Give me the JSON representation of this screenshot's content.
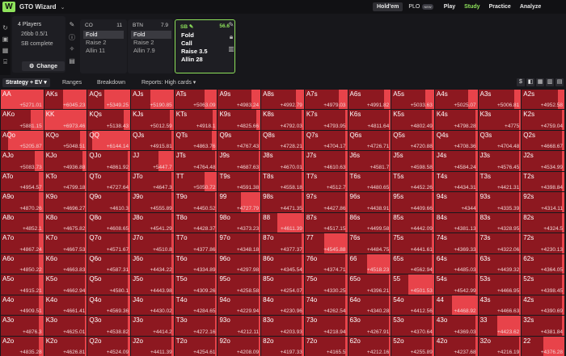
{
  "app": {
    "logo": "W",
    "brand": "GTO Wizard"
  },
  "nav": {
    "holdem": "Hold'em",
    "plo": "PLO",
    "new_badge": "NEW",
    "play": "Play",
    "study": "Study",
    "practice": "Practice",
    "analyze": "Analyze"
  },
  "settings": {
    "players": "4 Players",
    "stakes": "26bb 0.5/1",
    "status": "SB complete",
    "change_label": "Change"
  },
  "positions": [
    {
      "name": "CO",
      "stack": "11",
      "actions": [
        "Fold",
        "Raise 2",
        "Allin 11"
      ],
      "selected": 0
    },
    {
      "name": "BTN",
      "stack": "7.9",
      "actions": [
        "Fold",
        "Raise 2",
        "Allin 7.9"
      ],
      "selected": 0
    },
    {
      "name": "SB",
      "stack": "56.6",
      "actions": [
        "Fold",
        "Call",
        "Raise 3.5",
        "Allin 28"
      ],
      "selected": -1
    }
  ],
  "tabs": {
    "strategy": "Strategy + EV",
    "ranges": "Ranges",
    "breakdown": "Breakdown",
    "reports": "Reports: High cards"
  },
  "colors": {
    "accent": "#8ee25b",
    "fold": "#8d1820",
    "allin": "#e8434a"
  },
  "grid_rows": [
    [
      [
        "AA",
        "+5271.01",
        1
      ],
      [
        "AKs",
        "+6045.23",
        0.55
      ],
      [
        "AQs",
        "+5349.25",
        0.6
      ],
      [
        "AJs",
        "+5190.85",
        0.55
      ],
      [
        "ATs",
        "+5063.09",
        0.3
      ],
      [
        "A9s",
        "+4983.24",
        0.22
      ],
      [
        "A8s",
        "+4992.79",
        0.18
      ],
      [
        "A7s",
        "+4979.03",
        0.2
      ],
      [
        "A6s",
        "+4991.82",
        0.15
      ],
      [
        "A5s",
        "+5033.63",
        0.2
      ],
      [
        "A4s",
        "+5025.07",
        0.22
      ],
      [
        "A3s",
        "+5006.81",
        0.15
      ],
      [
        "A2s",
        "+4952.58",
        0.15
      ]
    ],
    [
      [
        "AKo",
        "+5881.15",
        0.3
      ],
      [
        "KK",
        "+6973.46",
        1
      ],
      [
        "KQs",
        "+5138.43",
        0.15
      ],
      [
        "KJs",
        "+5012.59",
        0.1
      ],
      [
        "KTs",
        "+4918.1",
        0.1
      ],
      [
        "K9s",
        "+4825.66",
        0.1
      ],
      [
        "K8s",
        "+4792.03",
        0.06
      ],
      [
        "K7s",
        "+4793.95",
        0.05
      ],
      [
        "K6s",
        "+4811.64",
        0.05
      ],
      [
        "K5s",
        "+4802.49",
        0.05
      ],
      [
        "K4s",
        "+4798.28",
        0.05
      ],
      [
        "K3s",
        "+4775",
        0.05
      ],
      [
        "K2s",
        "+4759.04",
        0.05
      ]
    ],
    [
      [
        "AQo",
        "+5205.87",
        0.82
      ],
      [
        "KQo",
        "+5048.51",
        0.15
      ],
      [
        "QQ",
        "+6144.14",
        0.9
      ],
      [
        "QJs",
        "+4915.81",
        0.05
      ],
      [
        "QTs",
        "+4863.76",
        0.12
      ],
      [
        "Q9s",
        "+4767.43",
        0.05
      ],
      [
        "Q8s",
        "+4728.21",
        0.05
      ],
      [
        "Q7s",
        "+4704.17",
        0.05
      ],
      [
        "Q6s",
        "+4726.71",
        0.05
      ],
      [
        "Q5s",
        "+4720.88",
        0.05
      ],
      [
        "Q4s",
        "+4708.36",
        0.05
      ],
      [
        "Q3s",
        "+4704.48",
        0.05
      ],
      [
        "Q2s",
        "+4668.67",
        0.05
      ]
    ],
    [
      [
        "AJo",
        "+5083.73",
        0.2
      ],
      [
        "KJo",
        "+4936.88",
        0.1
      ],
      [
        "QJo",
        "+4861.92",
        0.05
      ],
      [
        "JJ",
        "+5447.7",
        0.35
      ],
      [
        "JTs",
        "+4764.48",
        0.05
      ],
      [
        "J9s",
        "+4687.63",
        0.05
      ],
      [
        "J8s",
        "+4670.01",
        0.05
      ],
      [
        "J7s",
        "+4610.63",
        0.05
      ],
      [
        "J6s",
        "+4581.7",
        0.05
      ],
      [
        "J5s",
        "+4598.58",
        0.05
      ],
      [
        "J4s",
        "+4584.24",
        0.05
      ],
      [
        "J3s",
        "+4576.45",
        0.05
      ],
      [
        "J2s",
        "+4534.99",
        0.05
      ]
    ],
    [
      [
        "ATo",
        "+4954.57",
        0.1
      ],
      [
        "KTo",
        "+4799.18",
        0.05
      ],
      [
        "QTo",
        "+4727.64",
        0.05
      ],
      [
        "JTo",
        "+4647.3",
        0.05
      ],
      [
        "TT",
        "+5050.72",
        0.3
      ],
      [
        "T9s",
        "+4591.38",
        0.05
      ],
      [
        "T8s",
        "+4558.18",
        0.05
      ],
      [
        "T7s",
        "+4512.7",
        0.05
      ],
      [
        "T6s",
        "+4480.65",
        0.05
      ],
      [
        "T5s",
        "+4452.26",
        0.05
      ],
      [
        "T4s",
        "+4434.31",
        0.05
      ],
      [
        "T3s",
        "+4421.31",
        0.05
      ],
      [
        "T2s",
        "+4398.84",
        0.05
      ]
    ],
    [
      [
        "A9o",
        "+4870.26",
        0.1
      ],
      [
        "K9o",
        "+4696.27",
        0.05
      ],
      [
        "Q9o",
        "+4610.3",
        0.05
      ],
      [
        "J9o",
        "+4555.89",
        0.05
      ],
      [
        "T9o",
        "+4450.52",
        0.05
      ],
      [
        "99",
        "+4727.79",
        0.45
      ],
      [
        "98s",
        "+4471.35",
        0.05
      ],
      [
        "97s",
        "+4427.86",
        0.05
      ],
      [
        "96s",
        "+4438.91",
        0.05
      ],
      [
        "95s",
        "+4409.66",
        0.05
      ],
      [
        "94s",
        "+4344",
        0.05
      ],
      [
        "93s",
        "+4335.39",
        0.05
      ],
      [
        "92s",
        "+4314.11",
        0.05
      ]
    ],
    [
      [
        "A8o",
        "+4852.1",
        0.1
      ],
      [
        "K8o",
        "+4675.82",
        0.05
      ],
      [
        "Q8o",
        "+4608.65",
        0.05
      ],
      [
        "J8o",
        "+4541.29",
        0.05
      ],
      [
        "T8o",
        "+4428.37",
        0.05
      ],
      [
        "98o",
        "+4373.23",
        0.05
      ],
      [
        "88",
        "+4611.39",
        0.62
      ],
      [
        "87s",
        "+4517.15",
        0.05
      ],
      [
        "86s",
        "+4499.58",
        0.05
      ],
      [
        "85s",
        "+4442.09",
        0.05
      ],
      [
        "84s",
        "+4381.13",
        0.05
      ],
      [
        "83s",
        "+4328.95",
        0.05
      ],
      [
        "82s",
        "+4324.5",
        0.05
      ]
    ],
    [
      [
        "A7o",
        "+4867.24",
        0.1
      ],
      [
        "K7o",
        "+4667.53",
        0.05
      ],
      [
        "Q7o",
        "+4571.67",
        0.05
      ],
      [
        "J7o",
        "+4510.8",
        0.05
      ],
      [
        "T7o",
        "+4377.86",
        0.05
      ],
      [
        "97o",
        "+4348.18",
        0.05
      ],
      [
        "87o",
        "+4377.37",
        0.05
      ],
      [
        "77",
        "+4545.88",
        0.55
      ],
      [
        "76s",
        "+4484.75",
        0.05
      ],
      [
        "75s",
        "+4441.61",
        0.05
      ],
      [
        "74s",
        "+4369.33",
        0.05
      ],
      [
        "73s",
        "+4322.06",
        0.05
      ],
      [
        "72s",
        "+4230.13",
        0.05
      ]
    ],
    [
      [
        "A6o",
        "+4850.22",
        0.1
      ],
      [
        "K6o",
        "+4663.83",
        0.05
      ],
      [
        "Q6o",
        "+4587.31",
        0.05
      ],
      [
        "J6o",
        "+4434.22",
        0.05
      ],
      [
        "T6o",
        "+4334.89",
        0.05
      ],
      [
        "96o",
        "+4297.98",
        0.05
      ],
      [
        "86o",
        "+4345.54",
        0.05
      ],
      [
        "76o",
        "+4374.71",
        0.05
      ],
      [
        "66",
        "+4518.23",
        0.55
      ],
      [
        "65s",
        "+4562.94",
        0.05
      ],
      [
        "64s",
        "+4485.03",
        0.05
      ],
      [
        "63s",
        "+4439.32",
        0.05
      ],
      [
        "62s",
        "+4364.05",
        0.05
      ]
    ],
    [
      [
        "A5o",
        "+4915.21",
        0.1
      ],
      [
        "K5o",
        "+4662.94",
        0.05
      ],
      [
        "Q5o",
        "+4580.1",
        0.05
      ],
      [
        "J5o",
        "+4443.98",
        0.05
      ],
      [
        "T5o",
        "+4309.26",
        0.05
      ],
      [
        "95o",
        "+4258.58",
        0.05
      ],
      [
        "85o",
        "+4254.07",
        0.05
      ],
      [
        "75o",
        "+4330.25",
        0.05
      ],
      [
        "65o",
        "+4396.21",
        0.05
      ],
      [
        "55",
        "+4501.53",
        0.6
      ],
      [
        "54s",
        "+4542.99",
        0.05
      ],
      [
        "53s",
        "+4466.95",
        0.05
      ],
      [
        "52s",
        "+4398.45",
        0.05
      ]
    ],
    [
      [
        "A4o",
        "+4909.51",
        0.1
      ],
      [
        "K4o",
        "+4661.41",
        0.05
      ],
      [
        "Q4o",
        "+4569.36",
        0.05
      ],
      [
        "J4o",
        "+4430.02",
        0.05
      ],
      [
        "T4o",
        "+4284.65",
        0.05
      ],
      [
        "94o",
        "+4229.94",
        0.05
      ],
      [
        "84o",
        "+4230.96",
        0.05
      ],
      [
        "74o",
        "+4262.54",
        0.05
      ],
      [
        "64o",
        "+4340.28",
        0.05
      ],
      [
        "54o",
        "+4412.56",
        0.05
      ],
      [
        "44",
        "+4468.92",
        0.6
      ],
      [
        "43s",
        "+4466.63",
        0.05
      ],
      [
        "42s",
        "+4390.69",
        0.05
      ]
    ],
    [
      [
        "A3o",
        "+4876.3",
        0.1
      ],
      [
        "K3o",
        "+4625.01",
        0.05
      ],
      [
        "Q3o",
        "+4538.82",
        0.05
      ],
      [
        "J3o",
        "+4414.2",
        0.05
      ],
      [
        "T3o",
        "+4272.16",
        0.05
      ],
      [
        "93o",
        "+4212.11",
        0.05
      ],
      [
        "83o",
        "+4203.93",
        0.05
      ],
      [
        "73o",
        "+4218.94",
        0.05
      ],
      [
        "63o",
        "+4267.91",
        0.05
      ],
      [
        "53o",
        "+4370.64",
        0.05
      ],
      [
        "43o",
        "+4369.03",
        0.05
      ],
      [
        "33",
        "+4423.62",
        0.55
      ],
      [
        "32s",
        "+4381.84",
        0.05
      ]
    ],
    [
      [
        "A2o",
        "+4835.28",
        0.1
      ],
      [
        "K2o",
        "+4626.81",
        0.05
      ],
      [
        "Q2o",
        "+4524.09",
        0.05
      ],
      [
        "J2o",
        "+4411.39",
        0.05
      ],
      [
        "T2o",
        "+4254.61",
        0.05
      ],
      [
        "92o",
        "+4208.09",
        0.05
      ],
      [
        "82o",
        "+4197.33",
        0.05
      ],
      [
        "72o",
        "+4165.5",
        0.05
      ],
      [
        "62o",
        "+4212.16",
        0.05
      ],
      [
        "52o",
        "+4255.89",
        0.05
      ],
      [
        "42o",
        "+4237.68",
        0.05
      ],
      [
        "32o",
        "+4216.19",
        0.05
      ],
      [
        "22",
        "+4376.28",
        0.5
      ]
    ]
  ]
}
